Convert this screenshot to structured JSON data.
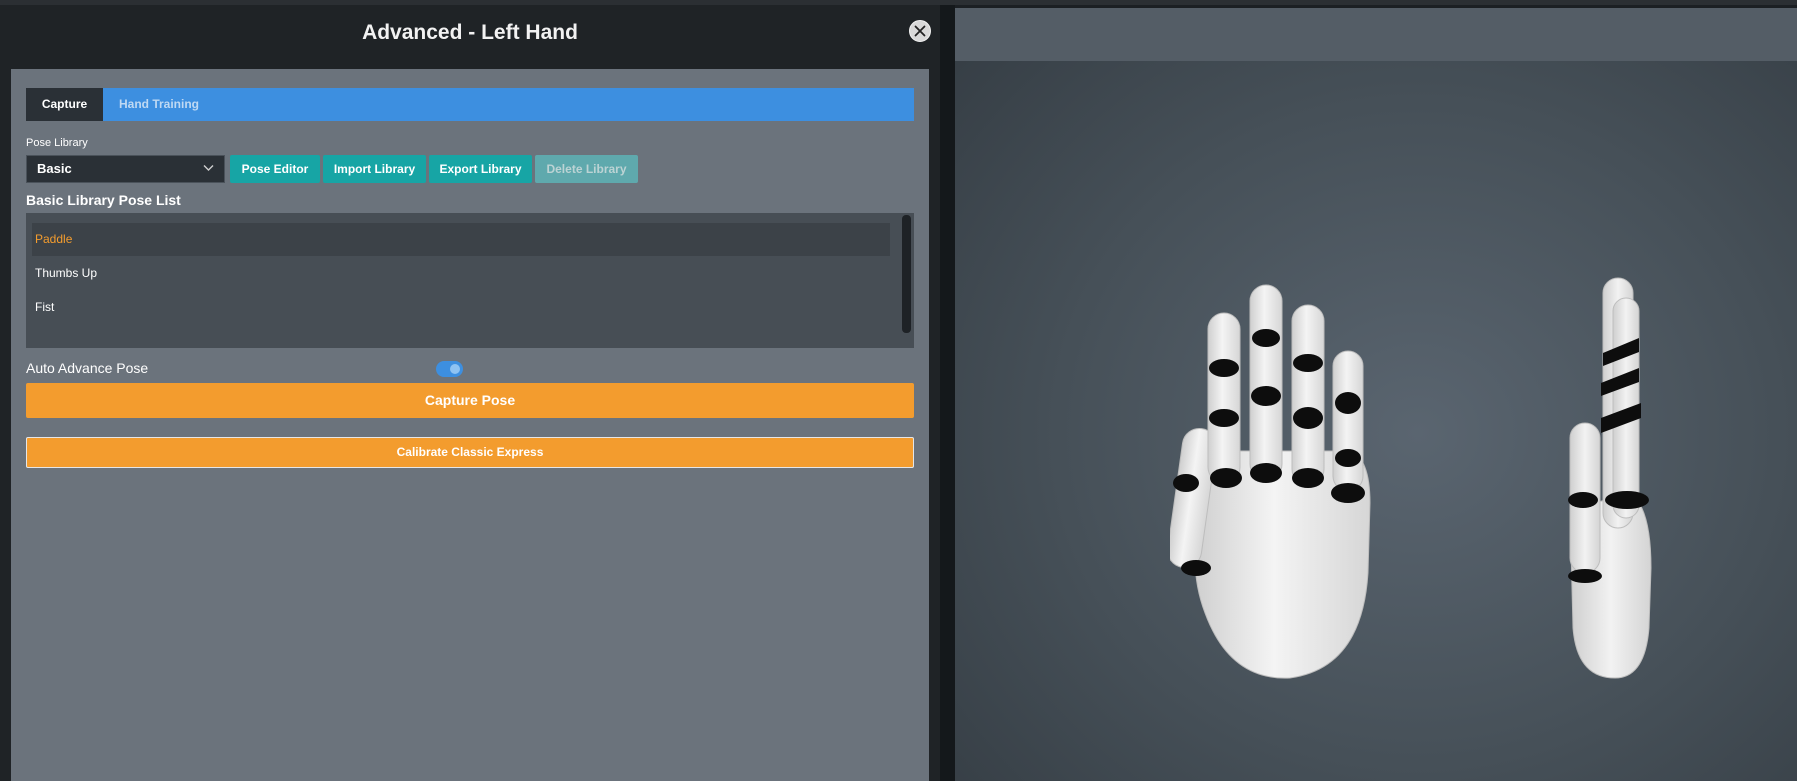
{
  "modal": {
    "title": "Advanced - Left Hand"
  },
  "tabs": [
    {
      "label": "Capture",
      "active": true
    },
    {
      "label": "Hand Training",
      "active": false
    }
  ],
  "pose_library": {
    "label": "Pose Library",
    "selected": "Basic"
  },
  "toolbar": {
    "pose_editor": "Pose Editor",
    "import_library": "Import Library",
    "export_library": "Export Library",
    "delete_library": "Delete Library"
  },
  "pose_list": {
    "title": "Basic Library Pose List",
    "items": [
      {
        "label": "Paddle",
        "selected": true
      },
      {
        "label": "Thumbs Up",
        "selected": false
      },
      {
        "label": "Fist",
        "selected": false
      }
    ]
  },
  "auto_advance": {
    "label": "Auto Advance Pose",
    "enabled": true
  },
  "actions": {
    "capture_pose": "Capture Pose",
    "calibrate": "Calibrate Classic Express"
  },
  "colors": {
    "accent_blue": "#3d8fe0",
    "teal_button": "#17a5a5",
    "orange_button": "#f39c2e",
    "selected_text": "#f39c2e"
  },
  "icons": {
    "close": "close-icon",
    "dropdown": "chevron-down-icon"
  }
}
